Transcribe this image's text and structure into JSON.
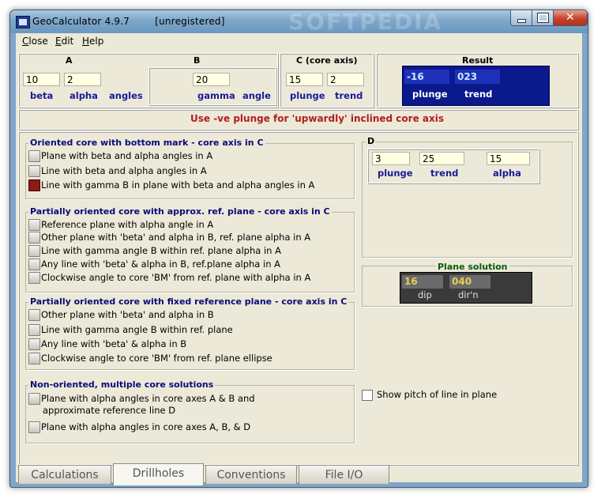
{
  "window": {
    "title": "GeoCalculator 4.9.7        [unregistered]",
    "watermark": "SOFTPEDIA"
  },
  "menu": [
    "Close",
    "Edit",
    "Help"
  ],
  "inputs": {
    "A": {
      "title": "A",
      "beta": "10",
      "alpha": "2",
      "labels": [
        "beta",
        "alpha",
        "angles"
      ]
    },
    "B": {
      "title": "B",
      "gamma": "20",
      "labels": [
        "gamma",
        "angle"
      ]
    },
    "C": {
      "title": "C  (core axis)",
      "plunge": "15",
      "trend": "2",
      "labels": [
        "plunge",
        "trend"
      ]
    },
    "result": {
      "title": "Result",
      "plunge": "-16",
      "trend": "023",
      "labels": [
        "plunge",
        "trend"
      ]
    }
  },
  "hint": "Use -ve plunge for 'upwardly' inclined core axis",
  "groups": [
    {
      "title": "Oriented core with bottom mark  - core axis in C",
      "options": [
        "Plane with beta and alpha angles in A",
        "Line with beta and alpha angles in A",
        "Line with gamma B in plane with beta and alpha angles in A"
      ],
      "selected": 2
    },
    {
      "title": "Partially oriented core with approx. ref. plane - core axis in C",
      "options": [
        "Reference plane with alpha angle in A",
        "Other plane with 'beta' and alpha in B, ref. plane alpha in A",
        "Line with gamma angle B within ref. plane alpha in A",
        "Any line with 'beta' & alpha in B, ref.plane alpha in A",
        "Clockwise angle to core 'BM' from ref. plane with alpha in A"
      ]
    },
    {
      "title": "Partially oriented core with fixed reference plane - core axis in C",
      "options": [
        "Other plane with 'beta' and alpha in B",
        "Line with gamma angle B within ref. plane",
        "Any line with 'beta' & alpha in B",
        "Clockwise angle to core 'BM' from ref. plane ellipse"
      ]
    },
    {
      "title": "Non-oriented, multiple core solutions",
      "options": [
        "Plane with alpha angles in core axes A & B and",
        "Plane with alpha angles in core axes A, B, & D"
      ],
      "option_extra": "approximate reference line D"
    }
  ],
  "D": {
    "title": "D",
    "plunge": "3",
    "trend": "25",
    "alpha": "15",
    "labels": [
      "plunge",
      "trend",
      "alpha"
    ]
  },
  "plane_solution": {
    "title": "Plane solution",
    "dip": "16",
    "dirn": "040",
    "labels": [
      "dip",
      "dir'n"
    ]
  },
  "show_pitch": {
    "label": "Show pitch of line in plane",
    "checked": false
  },
  "tabs": [
    "Calculations",
    "Drillholes",
    "Conventions",
    "File I/O"
  ],
  "active_tab": "Drillholes"
}
